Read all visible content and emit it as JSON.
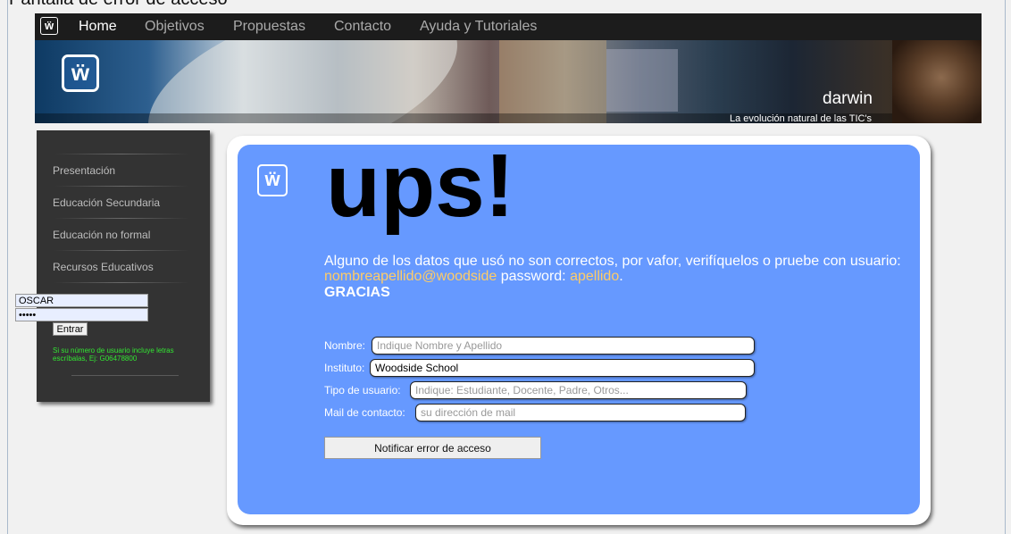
{
  "page_top_cut": "Pantalla de error de acceso",
  "nav": {
    "logo_glyph": "ẅ",
    "items": [
      {
        "label": "Home",
        "active": true
      },
      {
        "label": "Objetivos",
        "active": false
      },
      {
        "label": "Propuestas",
        "active": false
      },
      {
        "label": "Contacto",
        "active": false
      },
      {
        "label": "Ayuda y Tutoriales",
        "active": false
      }
    ]
  },
  "banner": {
    "logo_glyph": "ẅ",
    "title": "darwin",
    "tagline": "La evolución natural de las TIC's"
  },
  "sidebar": {
    "items": [
      {
        "label": "Presentación"
      },
      {
        "label": "Educación Secundaria"
      },
      {
        "label": "Educación no formal"
      },
      {
        "label": "Recursos Educativos"
      }
    ],
    "login": {
      "user_value": "OSCAR",
      "password_value": "•••••",
      "enter_label": "Entrar",
      "hint": "Si su número de usuario incluye letras escríbalas, Ej: G06478800"
    }
  },
  "main": {
    "logo_glyph": "ẅ",
    "heading": "ups!",
    "message": {
      "part1": "Alguno de los datos que usó no son correctos, por vafor, verifíquelos o pruebe con usuario: ",
      "user_example": "nombreapellido@woodside",
      "part2": " password: ",
      "password_example": "apellido",
      "part3": "."
    },
    "thanks": "GRACIAS",
    "form": {
      "name_label": "Nombre:",
      "name_placeholder": "Indique Nombre y Apellido",
      "name_value": "",
      "school_label": "Instituto:",
      "school_value": "Woodside School",
      "type_label": "Tipo de usuario:",
      "type_placeholder": "Indique: Estudiante, Docente, Padre, Otros...",
      "mail_label": "Mail de contacto:",
      "mail_placeholder": "su dirección de mail",
      "submit_label": "Notificar error de acceso"
    }
  },
  "colors": {
    "nav_bg": "#1c1c1c",
    "sidebar_bg": "#333333",
    "card_blue": "#6699ff",
    "highlight": "#ffcc66",
    "hint_green": "#33e633"
  }
}
